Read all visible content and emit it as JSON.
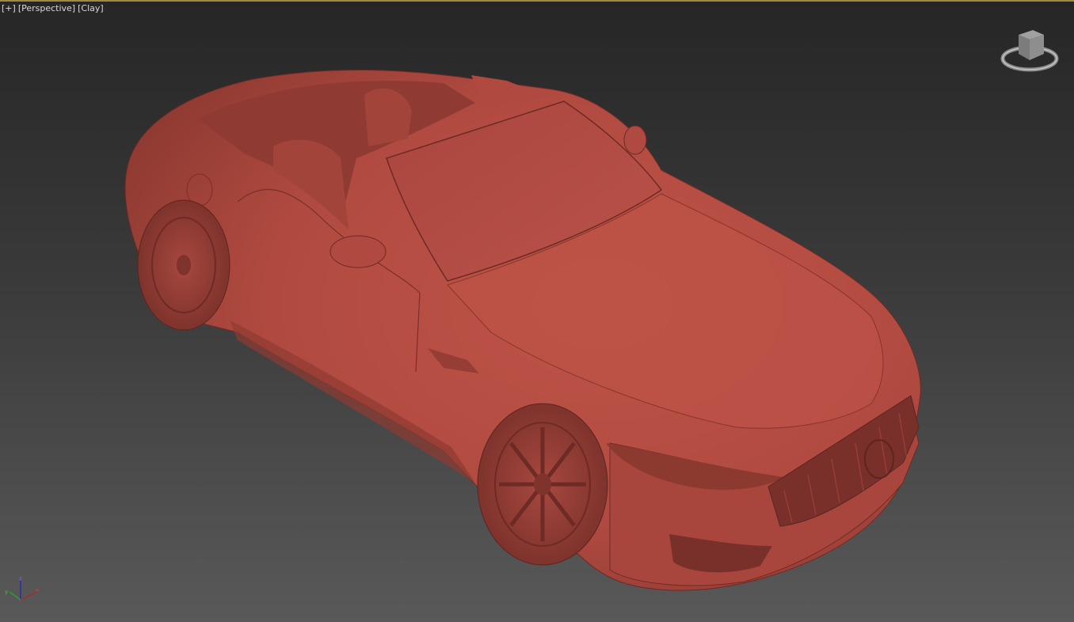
{
  "viewport": {
    "menu_plus": "[+]",
    "view_mode": "[Perspective]",
    "shading_mode": "[Clay]"
  },
  "axis_gizmo": {
    "z_label": "z",
    "x_label": "x",
    "y_label": "y"
  },
  "colors": {
    "clay": "#b24a40",
    "background_top": "#262626",
    "background_bottom": "#595959",
    "active_border": "#a08a3c"
  }
}
